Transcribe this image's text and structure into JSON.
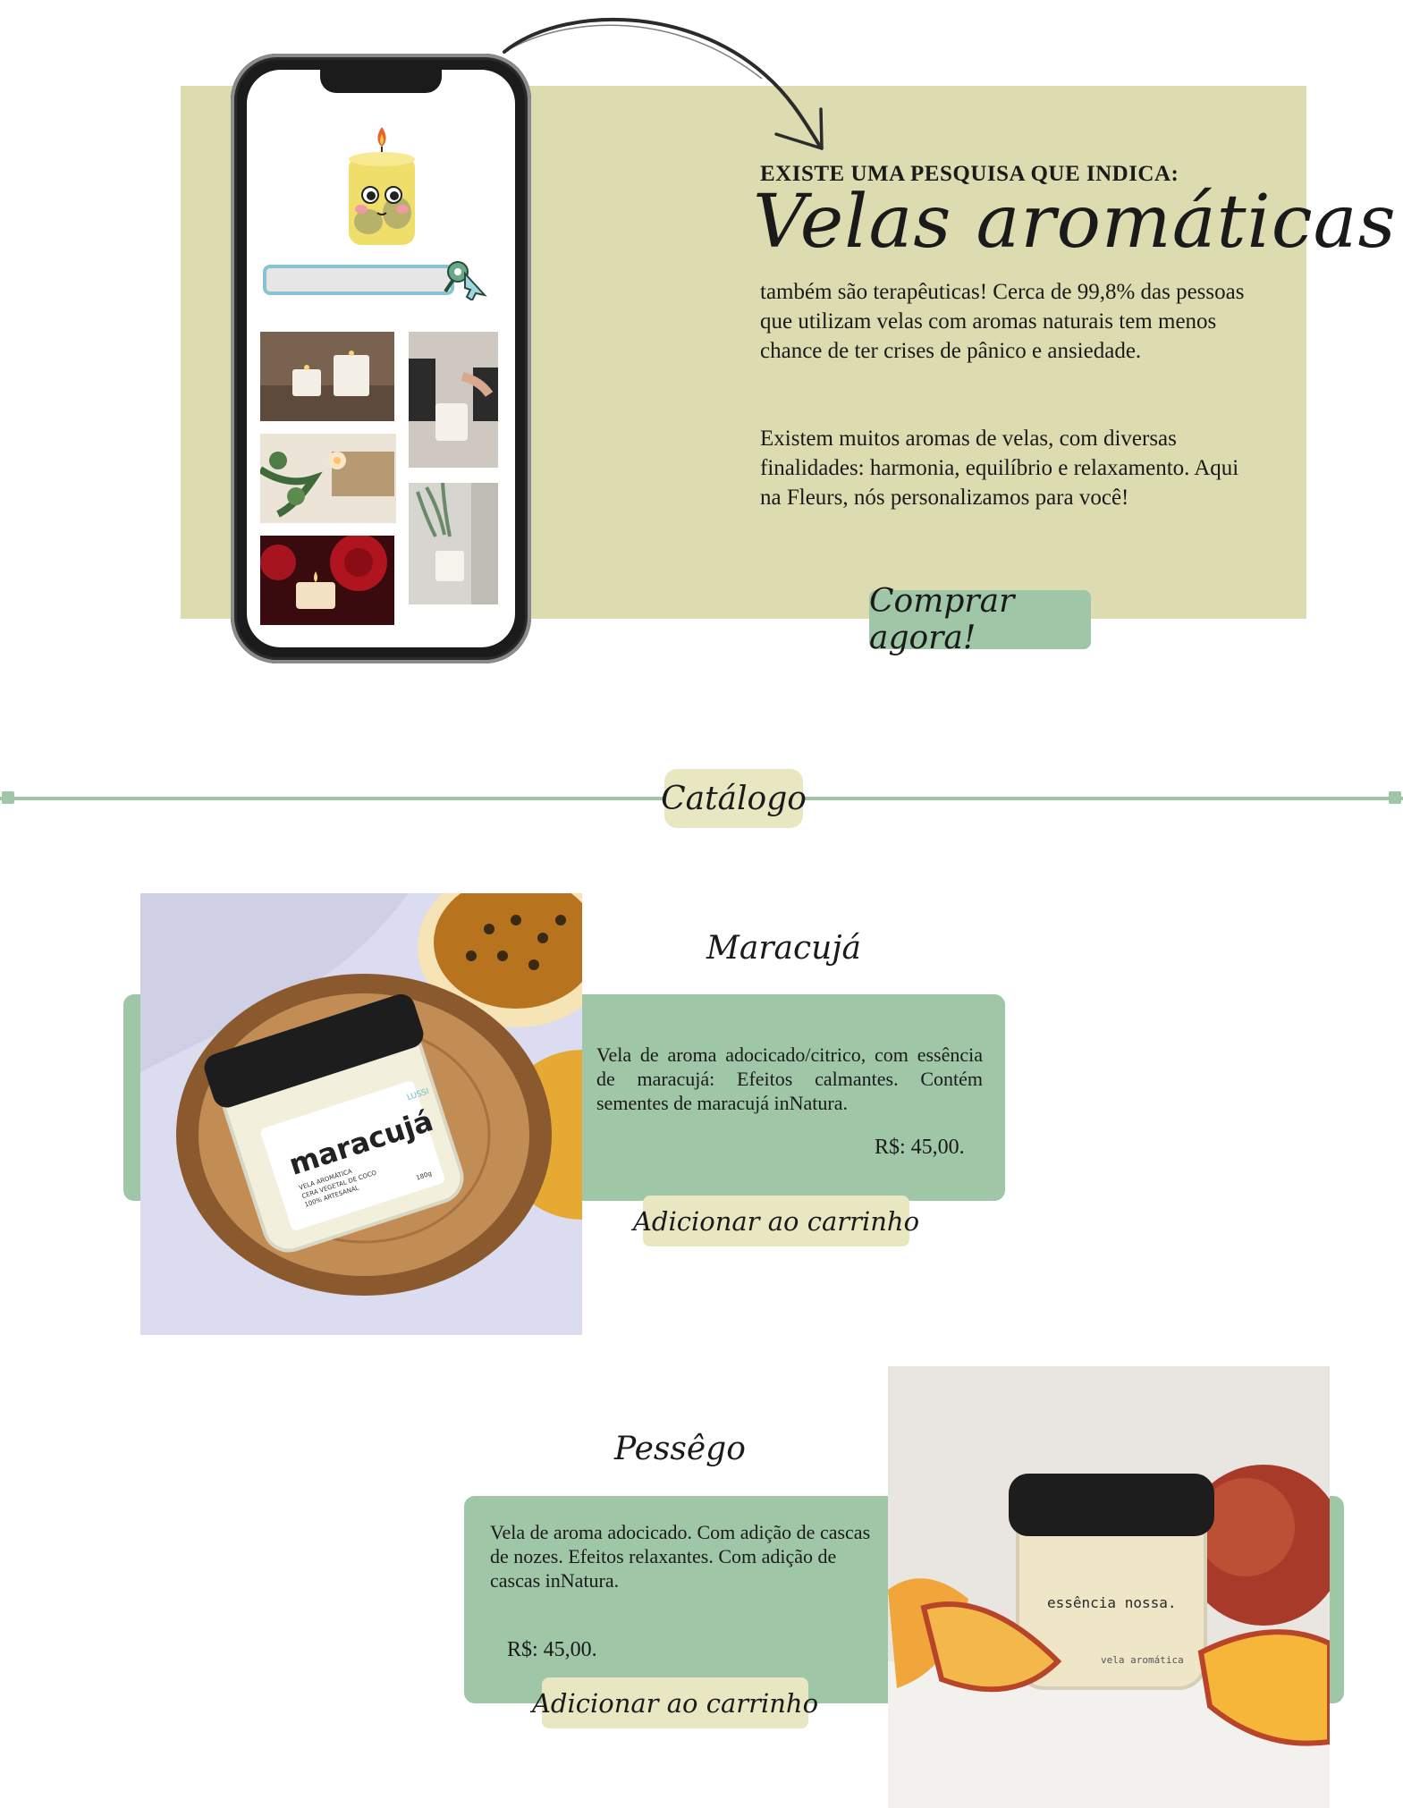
{
  "hero": {
    "kicker": "EXISTE UMA PESQUISA QUE INDICA:",
    "title": "Velas aromáticas",
    "paragraph_1": "também são terapêuticas! Cerca de 99,8% das pessoas que utilizam velas com aromas naturais tem menos chance de ter crises de pânico e ansiedade.",
    "paragraph_2": "Existem muitos aromas de velas, com diversas finalidades: harmonia, equilíbrio e relaxamento. Aqui na Fleurs, nós personalizamos para você!",
    "buy_button": "Comprar agora!"
  },
  "catalog": {
    "label": "Catálogo"
  },
  "products": [
    {
      "name": "Maracujá",
      "description": "Vela de aroma adocicado/citrico, com essência de maracujá: Efeitos calmantes. Contém sementes de maracujá inNatura.",
      "price": "R$: 45,00.",
      "cart_button": "Adicionar ao carrinho",
      "jar_label": "maracujá",
      "jar_small_lines": [
        "VELA AROMÁTICA",
        "CERA VEGETAL DE COCO",
        "100% ARTESANAL"
      ],
      "jar_weight": "180g",
      "jar_brand": "LUSSI"
    },
    {
      "name": "Pessêgo",
      "description": "Vela de aroma adocicado. Com adição de cascas de nozes. Efeitos relaxantes. Com adição de cascas inNatura.",
      "price": "R$: 45,00.",
      "cart_button": "Adicionar ao carrinho",
      "jar_label": "essência nossa.",
      "jar_sub": "vela aromática"
    }
  ],
  "colors": {
    "hero_bg": "#dddcb0",
    "accent_green": "#9ec6a7",
    "cream": "#e8e7c2"
  }
}
